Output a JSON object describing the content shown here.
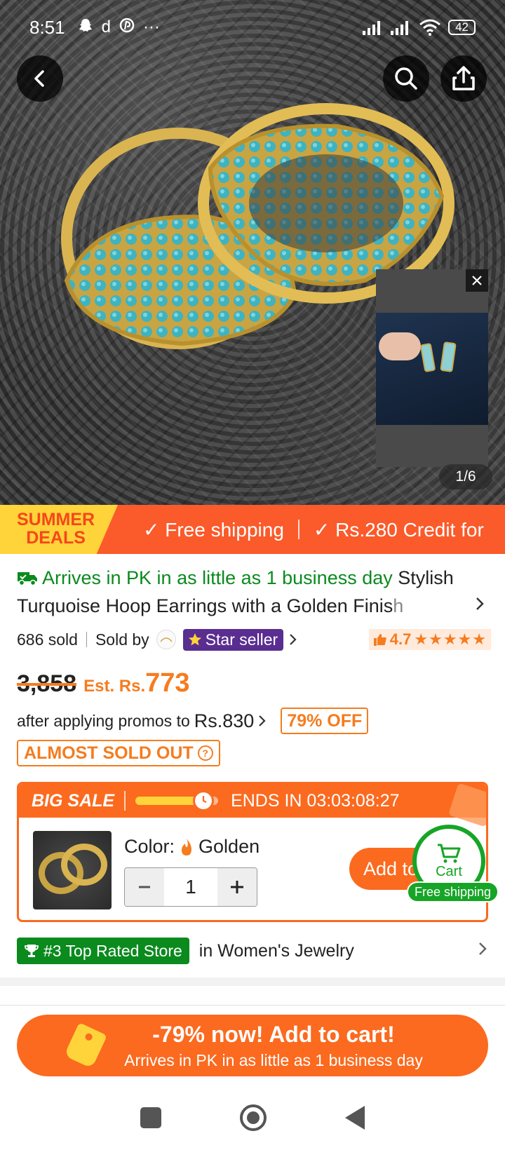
{
  "status_bar": {
    "time": "8:51",
    "left_icons": [
      "snapchat-icon",
      "d-app-icon",
      "pinterest-icon",
      "more-dots-icon"
    ],
    "d_glyph": "d",
    "more_glyph": "···",
    "battery": "42"
  },
  "gallery": {
    "counter": "1/6"
  },
  "promo_banner": {
    "badge_line1": "SUMMER",
    "badge_line2": "DEALS",
    "item1": "✓ Free shipping",
    "item2": "✓ Rs.280 Credit for"
  },
  "product": {
    "arrives": "Arrives in PK in as little as 1 business day",
    "title_main": " Stylish Turquoise Hoop Earrings with a Golden Finis",
    "title_fade": "h",
    "sold": "686 sold",
    "sold_by": "Sold by",
    "star_seller": "Star seller",
    "rating": "4.7",
    "stars": "★★★★★",
    "original_price": "3,858",
    "est_label": "Est. Rs.",
    "est_price": "773",
    "promo_text": "after applying promos to",
    "promo_value": "Rs.830",
    "discount": "79% OFF",
    "stock_badge": "ALMOST SOLD OUT"
  },
  "big_sale": {
    "title": "BIG SALE",
    "progress": 0.7,
    "ends": "ENDS IN 03:03:08:27",
    "color_label": "Color:",
    "color_value": "Golden",
    "quantity": "1",
    "add_label": "Add to",
    "cart_label": "Cart",
    "free_shipping": "Free shipping"
  },
  "store": {
    "badge": "#3 Top Rated Store",
    "category": "in Women's Jewelry"
  },
  "cta": {
    "title": "-79% now! Add to cart!",
    "subtitle": "Arrives in PK in as little as 1 business day"
  },
  "colors": {
    "accent": "#fb6a1f",
    "green": "#0b8a1e",
    "star_seller_purple": "#5a2d91",
    "banner_yellow": "#ffd33a"
  }
}
